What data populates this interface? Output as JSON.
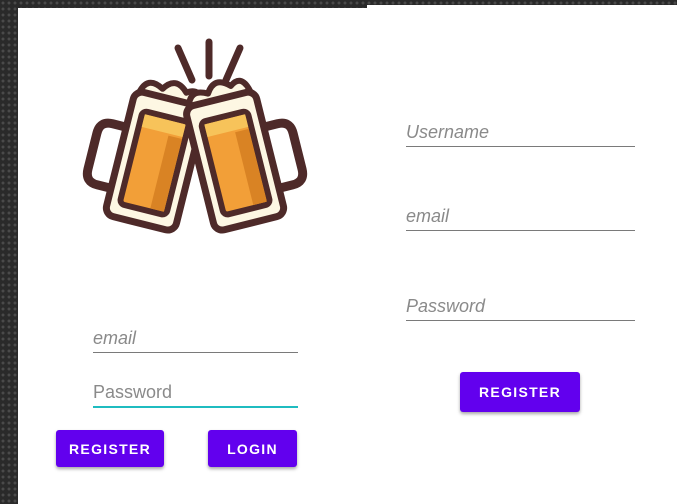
{
  "colors": {
    "accent": "#6200ee",
    "focus_underline": "#1fbcc0",
    "beer": "#f29f38",
    "beer_dark": "#d98324",
    "beer_light": "#f7c35a",
    "foam": "#fdf7e3",
    "outline": "#4e2a29"
  },
  "login": {
    "logo_icon": "beer-mugs-cheers-icon",
    "email_placeholder": "email",
    "password_placeholder": "Password",
    "register_label": "REGISTER",
    "login_label": "LOGIN"
  },
  "register": {
    "username_placeholder": "Username",
    "email_placeholder": "email",
    "password_placeholder": "Password",
    "register_label": "REGISTER"
  }
}
